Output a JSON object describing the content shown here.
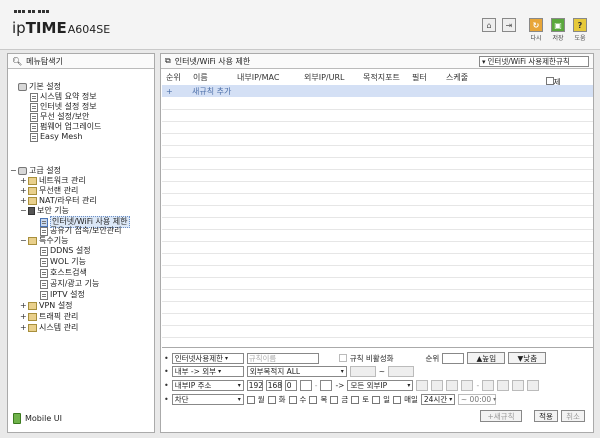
{
  "header": {
    "logo_ip": "ip",
    "logo_time": "TIME",
    "logo_model": "A604SE",
    "icons": [
      {
        "name": "home-icon",
        "glyph": "⌂"
      },
      {
        "name": "logout-icon",
        "glyph": "⇥"
      }
    ],
    "buttons": [
      {
        "name": "refresh",
        "glyph": "↻",
        "label": "다시"
      },
      {
        "name": "save",
        "glyph": "▣",
        "label": "저장"
      },
      {
        "name": "help",
        "glyph": "?",
        "label": "도움"
      }
    ]
  },
  "sidebar": {
    "title": "메뉴탐색기",
    "basic": {
      "label": "기본 설정",
      "items": [
        "시스템 요약 정보",
        "인터넷 설정 정보",
        "무선 설정/보안",
        "펌웨어 업그레이드",
        "Easy Mesh"
      ]
    },
    "advanced": {
      "label": "고급 설정",
      "network": "네트워크 관리",
      "wireless": "무선랜 관리",
      "nat": "NAT/라우터 관리",
      "security": {
        "label": "보안 기능",
        "items": [
          "인터넷/WiFi 사용 제한",
          "공유기 접속/보안관리"
        ]
      },
      "special": {
        "label": "특수기능",
        "items": [
          "DDNS 설정",
          "WOL 기능",
          "호스트검색",
          "공지/광고 기능",
          "IPTV 설정"
        ]
      },
      "vpn": "VPN 설정",
      "traffic": "트래픽 관리",
      "system": "시스템 관리"
    },
    "mobile": "Mobile UI"
  },
  "main": {
    "title": "인터넷/WiFi 사용 제한",
    "page_select": "인터넷/WiFi 사용제한규칙",
    "columns": [
      "순위",
      "이름",
      "내부IP/MAC",
      "외부IP/URL",
      "목적지포트",
      "필터",
      "스케줄",
      "삭제"
    ],
    "add_rule": "새규칙 추가",
    "add_plus": "+"
  },
  "form": {
    "type_select": "인터넷사용제한",
    "rule_name_placeholder": "규칙이름",
    "disable_rule": "규칙 비활성화",
    "priority_label": "순위",
    "up_button": "▲높임",
    "down_button": "▼낮춤",
    "direction_select": "내부 -> 외부",
    "dest_port_select": "외부목적지 ALL",
    "port_sep": "~",
    "internal_ip_select": "내부IP 주소",
    "ip1": "192",
    "ip2": "168",
    "ip3": "0",
    "arrow_label": "->",
    "external_ip_select": "모든 외부IP",
    "action_select": "차단",
    "days": [
      "월",
      "화",
      "수",
      "목",
      "금",
      "토",
      "일",
      "매일"
    ],
    "time_select": "24시간",
    "time_end": "~ 00:00",
    "add_button": "+새규칙",
    "apply_button": "적용",
    "cancel_button": "취소"
  }
}
